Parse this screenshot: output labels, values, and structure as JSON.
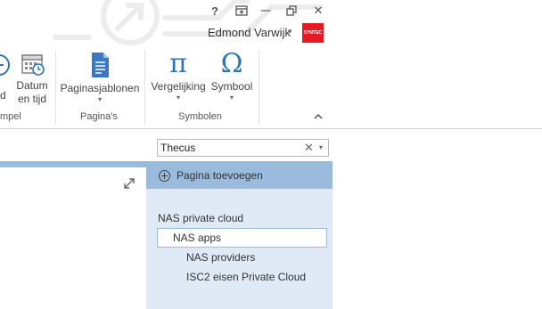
{
  "window": {
    "help_label": "?",
    "restore_ribbon_icon": "ribbon-display-options-icon",
    "minimize_label": "—",
    "maximize_icon": "restore-down-icon",
    "close_label": "✕"
  },
  "user": {
    "name": "Edmond Varwijk",
    "avatar_text": "SYNTEC",
    "avatar_color": "#e31b23"
  },
  "ribbon": {
    "groups": [
      {
        "label": "mpel"
      },
      {
        "label": "Pagina's"
      },
      {
        "label": "Symbolen"
      }
    ],
    "buttons": {
      "partial_left": "d",
      "datetime": {
        "line1": "Datum",
        "line2": "en tijd"
      },
      "page_templates": "Paginasjablonen",
      "equation": "Vergelijking",
      "equation_glyph": "π",
      "symbol": "Symbool",
      "symbol_glyph": "Ω"
    },
    "collapse_label": "^"
  },
  "search": {
    "value": "Thecus",
    "clear_label": "✕",
    "dropdown_label": "▾"
  },
  "pages_panel": {
    "add_page_label": "Pagina toevoegen",
    "pages": [
      {
        "label": "NAS private cloud",
        "level": 0
      },
      {
        "label": "NAS apps",
        "level": 1,
        "selected": true
      },
      {
        "label": "NAS providers",
        "level": 2
      },
      {
        "label": "ISC2 eisen Private Cloud",
        "level": 2
      }
    ]
  },
  "colors": {
    "accent_blue": "#2e75b6",
    "panel_bg": "#e0eaf6",
    "panel_header": "#9bbbdd"
  }
}
